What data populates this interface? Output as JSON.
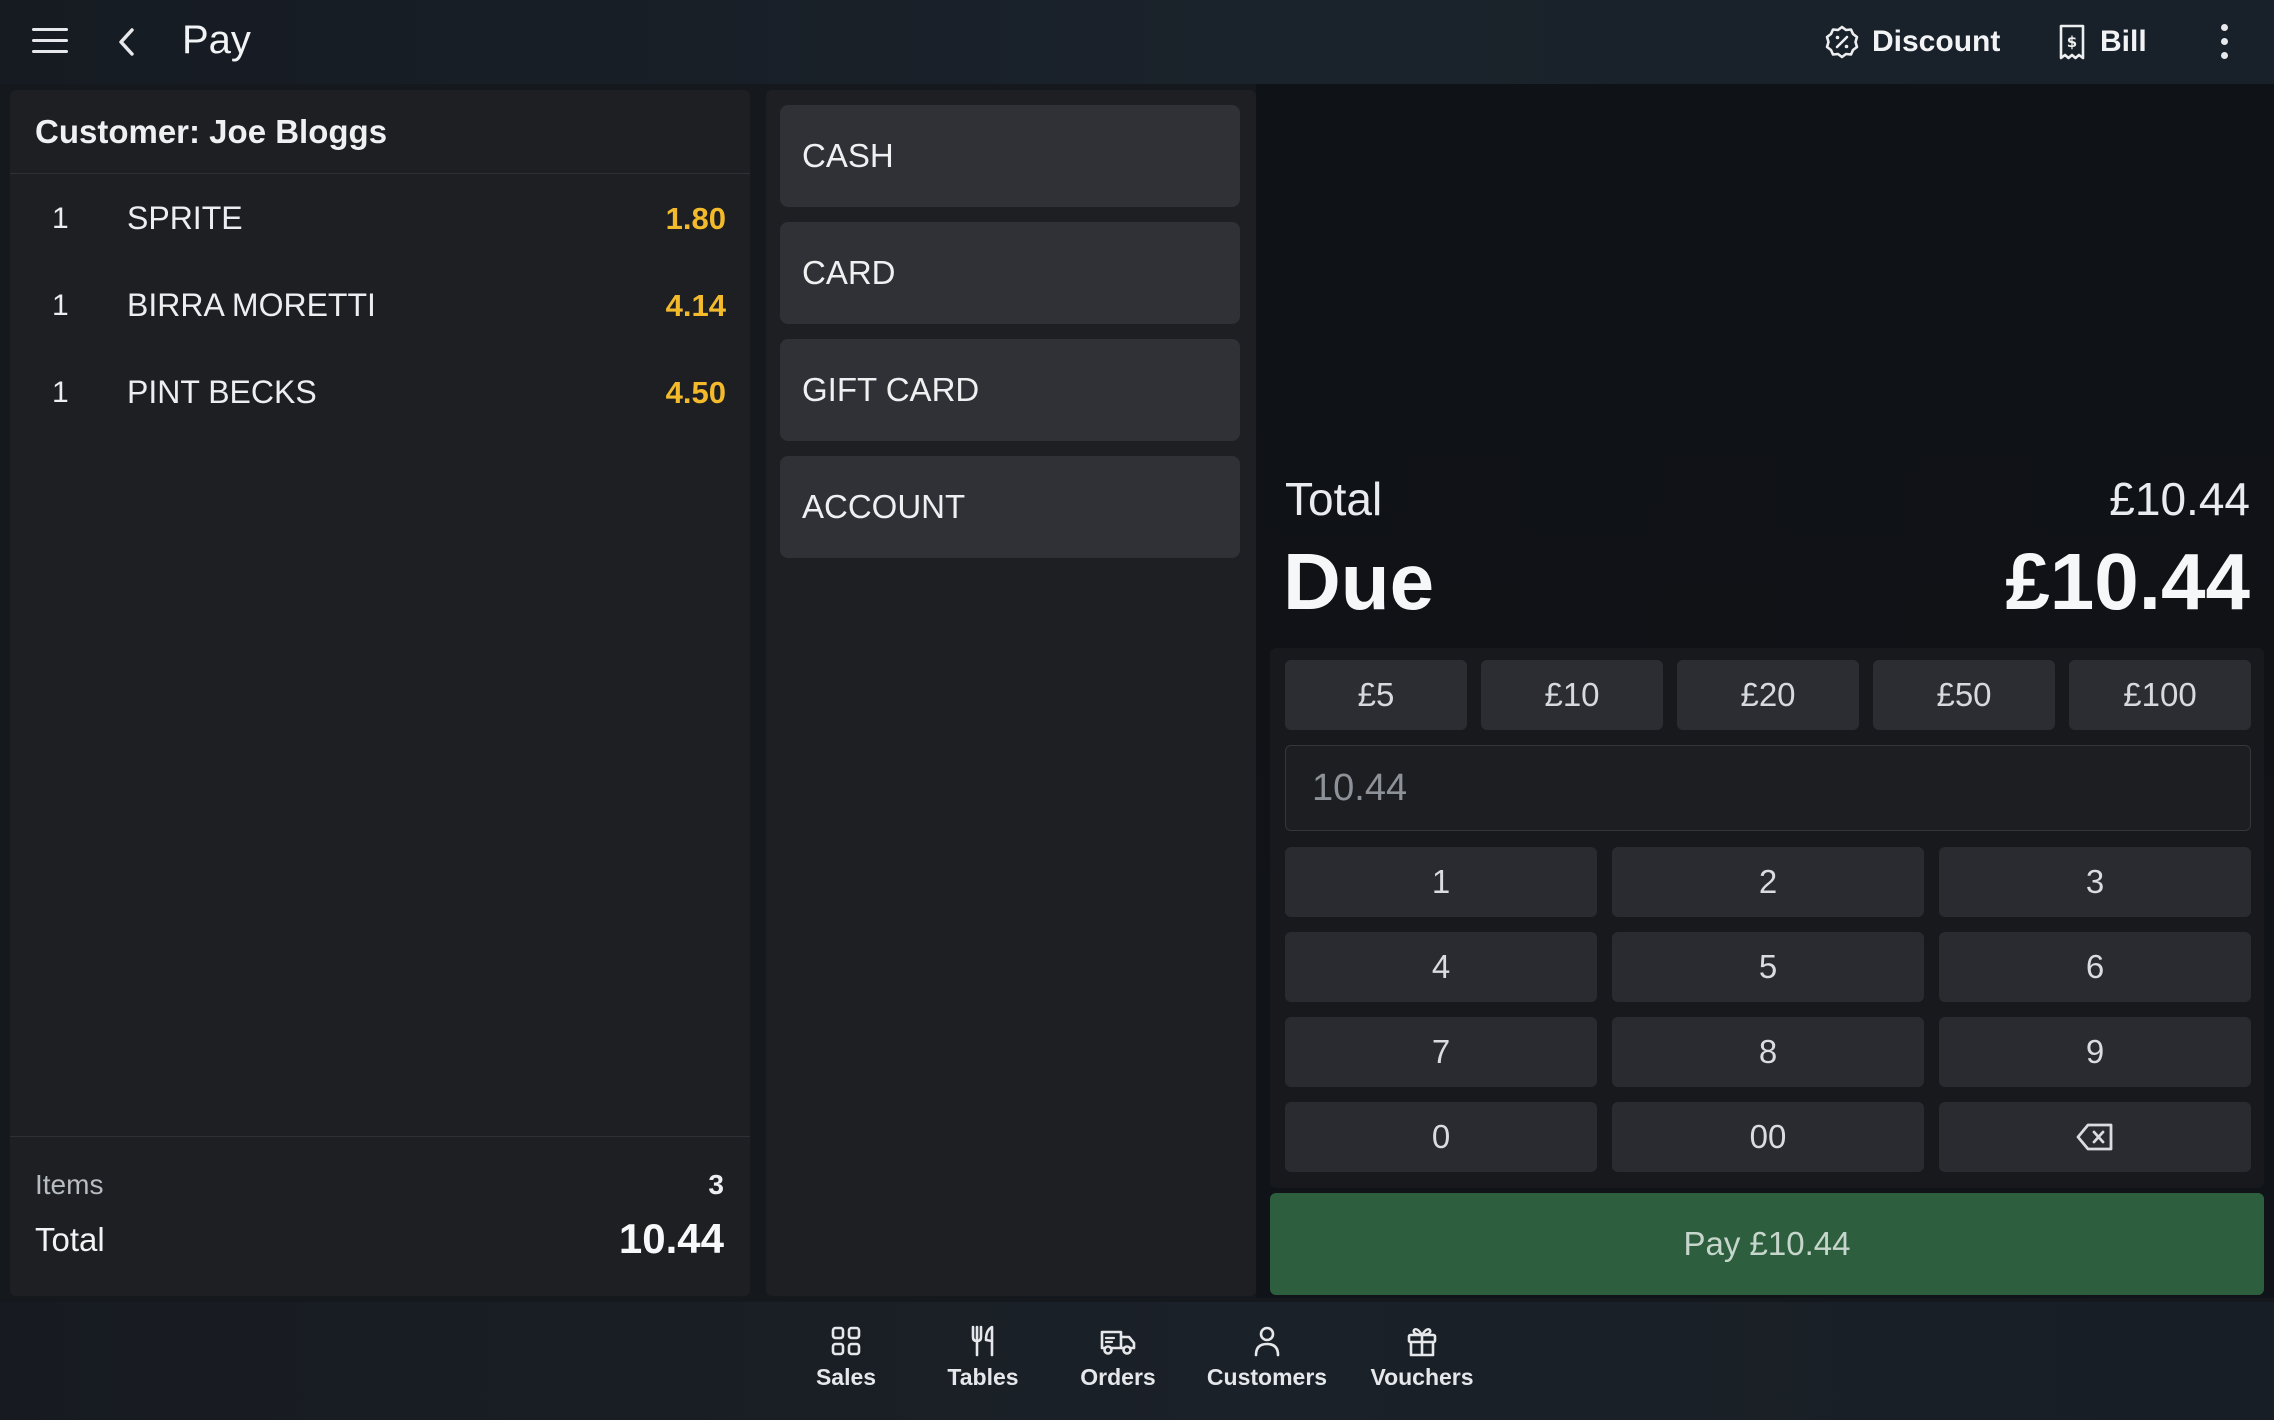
{
  "header": {
    "title": "Pay",
    "discount_label": "Discount",
    "bill_label": "Bill",
    "icons": [
      "hamburger-menu-icon",
      "back-chevron-icon",
      "discount-icon",
      "receipt-icon",
      "kebab-menu-icon"
    ]
  },
  "order": {
    "customer": "Customer: Joe Bloggs",
    "items": [
      {
        "qty": "1",
        "name": "SPRITE",
        "price": "1.80"
      },
      {
        "qty": "1",
        "name": "BIRRA MORETTI",
        "price": "4.14"
      },
      {
        "qty": "1",
        "name": "PINT BECKS",
        "price": "4.50"
      }
    ],
    "items_label": "Items",
    "items_count": "3",
    "total_label": "Total",
    "total_value": "10.44"
  },
  "payment_methods": [
    "CASH",
    "CARD",
    "GIFT CARD",
    "ACCOUNT"
  ],
  "summary": {
    "total_label": "Total",
    "total_value": "£10.44",
    "due_label": "Due",
    "due_value": "£10.44"
  },
  "quick_amounts": [
    "£5",
    "£10",
    "£20",
    "£50",
    "£100"
  ],
  "amount_input": {
    "placeholder": "10.44",
    "value": ""
  },
  "keypad": [
    "1",
    "2",
    "3",
    "4",
    "5",
    "6",
    "7",
    "8",
    "9",
    "0",
    "00"
  ],
  "pay_button": "Pay £10.44",
  "bottom_nav": {
    "sales": "Sales",
    "tables": "Tables",
    "orders": "Orders",
    "customers": "Customers",
    "vouchers": "Vouchers"
  },
  "colors": {
    "accent_price": "#f3bb2b",
    "pay_button": "#2d5f3f",
    "panel": "#1e1f23",
    "button": "#303136"
  }
}
